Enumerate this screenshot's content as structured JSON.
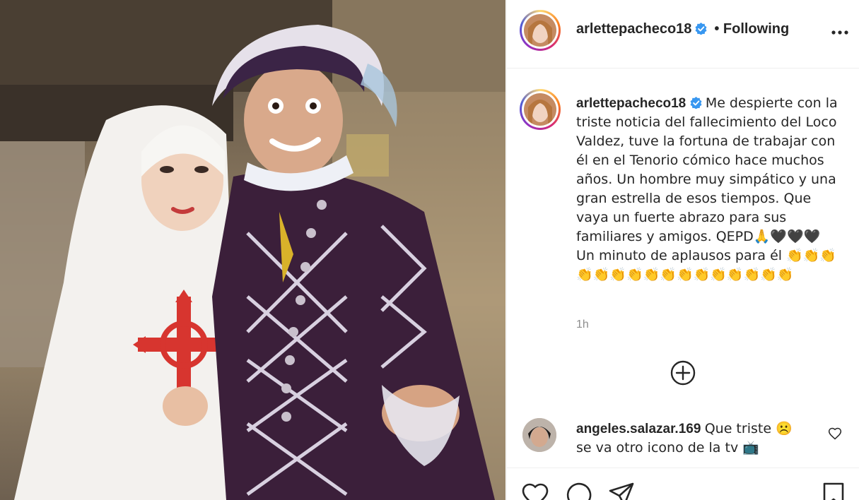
{
  "post": {
    "username": "arlettepacheco18",
    "follow_status": "• Following",
    "caption_text": "Me despierte con la triste noticia del fallecimiento del Loco Valdez, tuve la fortuna de trabajar con él en el Tenorio cómico hace muchos años. Un hombre muy simpático y una gran estrella de esos tiempos. Que vaya un fuerte abrazo para sus familiares y amigos. QEPD🙏🖤🖤🖤 Un minuto de aplausos para él 👏👏👏👏👏👏👏👏👏👏👏👏👏👏👏👏",
    "timestamp": "1h"
  },
  "comments": [
    {
      "username": "angeles.salazar.169",
      "text": "Que triste ☹️ se va otro icono de la tv 📺"
    }
  ],
  "icons": {
    "verified": "verified-badge-icon",
    "more": "more-options-icon",
    "load_more": "plus-circle-icon",
    "like": "heart-icon",
    "comment": "comment-icon",
    "share": "share-icon",
    "save": "bookmark-icon"
  },
  "colors": {
    "verified_blue": "#3897f0",
    "secondary_text": "#8e8e8e",
    "primary_text": "#262626"
  }
}
